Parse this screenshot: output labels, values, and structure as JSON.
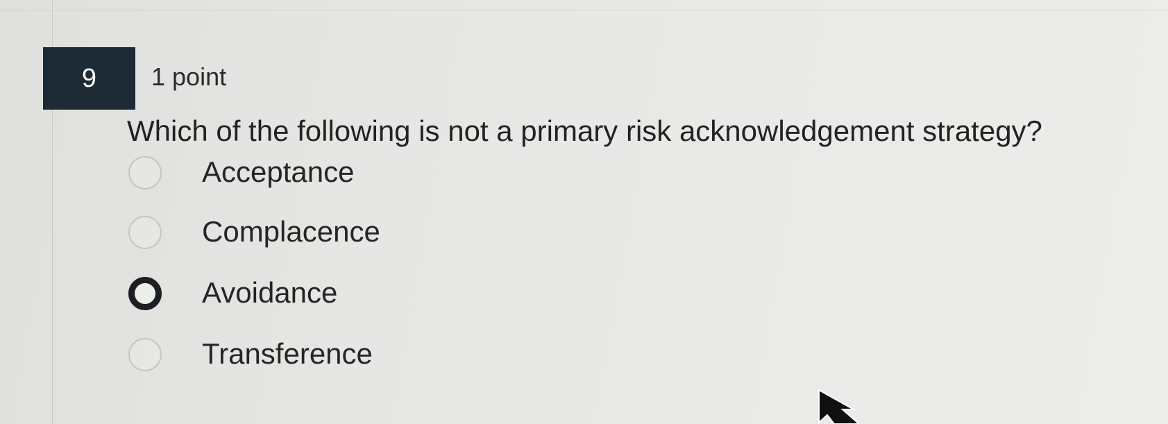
{
  "question": {
    "number": "9",
    "points": "1 point",
    "prompt": "Which of the following is not a primary risk acknowledgement strategy?",
    "options": [
      {
        "label": "Acceptance",
        "selected": false
      },
      {
        "label": "Complacence",
        "selected": false
      },
      {
        "label": "Avoidance",
        "selected": true
      },
      {
        "label": "Transference",
        "selected": false
      }
    ]
  },
  "icons": {
    "radio_unselected": "radio-empty-icon",
    "radio_selected": "radio-filled-icon",
    "cursor": "mouse-pointer-icon"
  },
  "colors": {
    "number_badge_bg": "#1e2a36",
    "selected_radio": "#1d1f22",
    "background": "#e6e7e4"
  }
}
